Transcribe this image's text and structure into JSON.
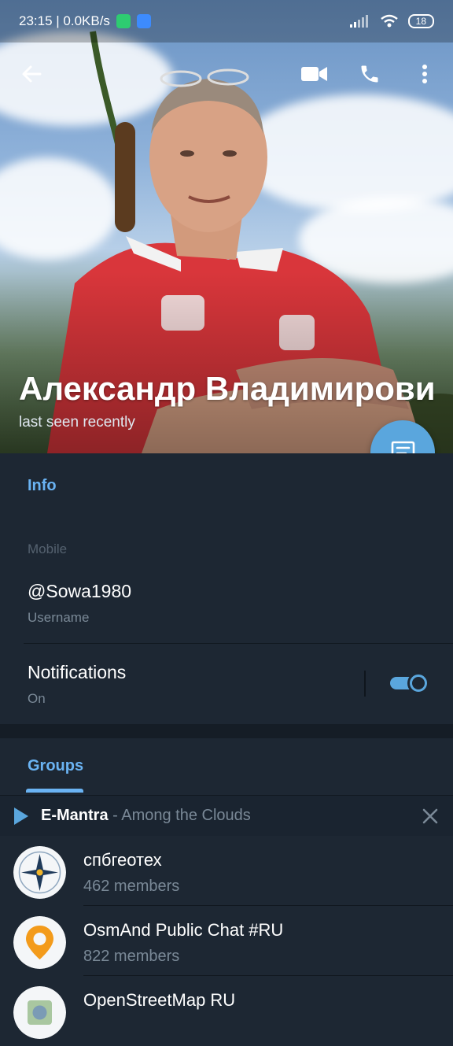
{
  "status_bar": {
    "time_speed": "23:15 | 0.0KB/s",
    "battery": "18"
  },
  "profile": {
    "name": "Александр Владимирови",
    "status": "last seen recently"
  },
  "info": {
    "section_title": "Info",
    "mobile_label": "Mobile",
    "username": "@Sowa1980",
    "username_label": "Username",
    "notifications_title": "Notifications",
    "notifications_state": "On",
    "notifications_enabled": true
  },
  "groups_tab": {
    "label": "Groups"
  },
  "player": {
    "artist": "E-Mantra",
    "separator": " - ",
    "title": "Among the Clouds"
  },
  "groups": [
    {
      "name": "спбгеотех",
      "members": "462 members"
    },
    {
      "name": "OsmAnd Public Chat #RU",
      "members": "822 members"
    },
    {
      "name": "OpenStreetMap RU",
      "members": ""
    }
  ],
  "colors": {
    "accent": "#6ab3f3",
    "fab": "#5aa6dd",
    "background": "#1d2733"
  }
}
